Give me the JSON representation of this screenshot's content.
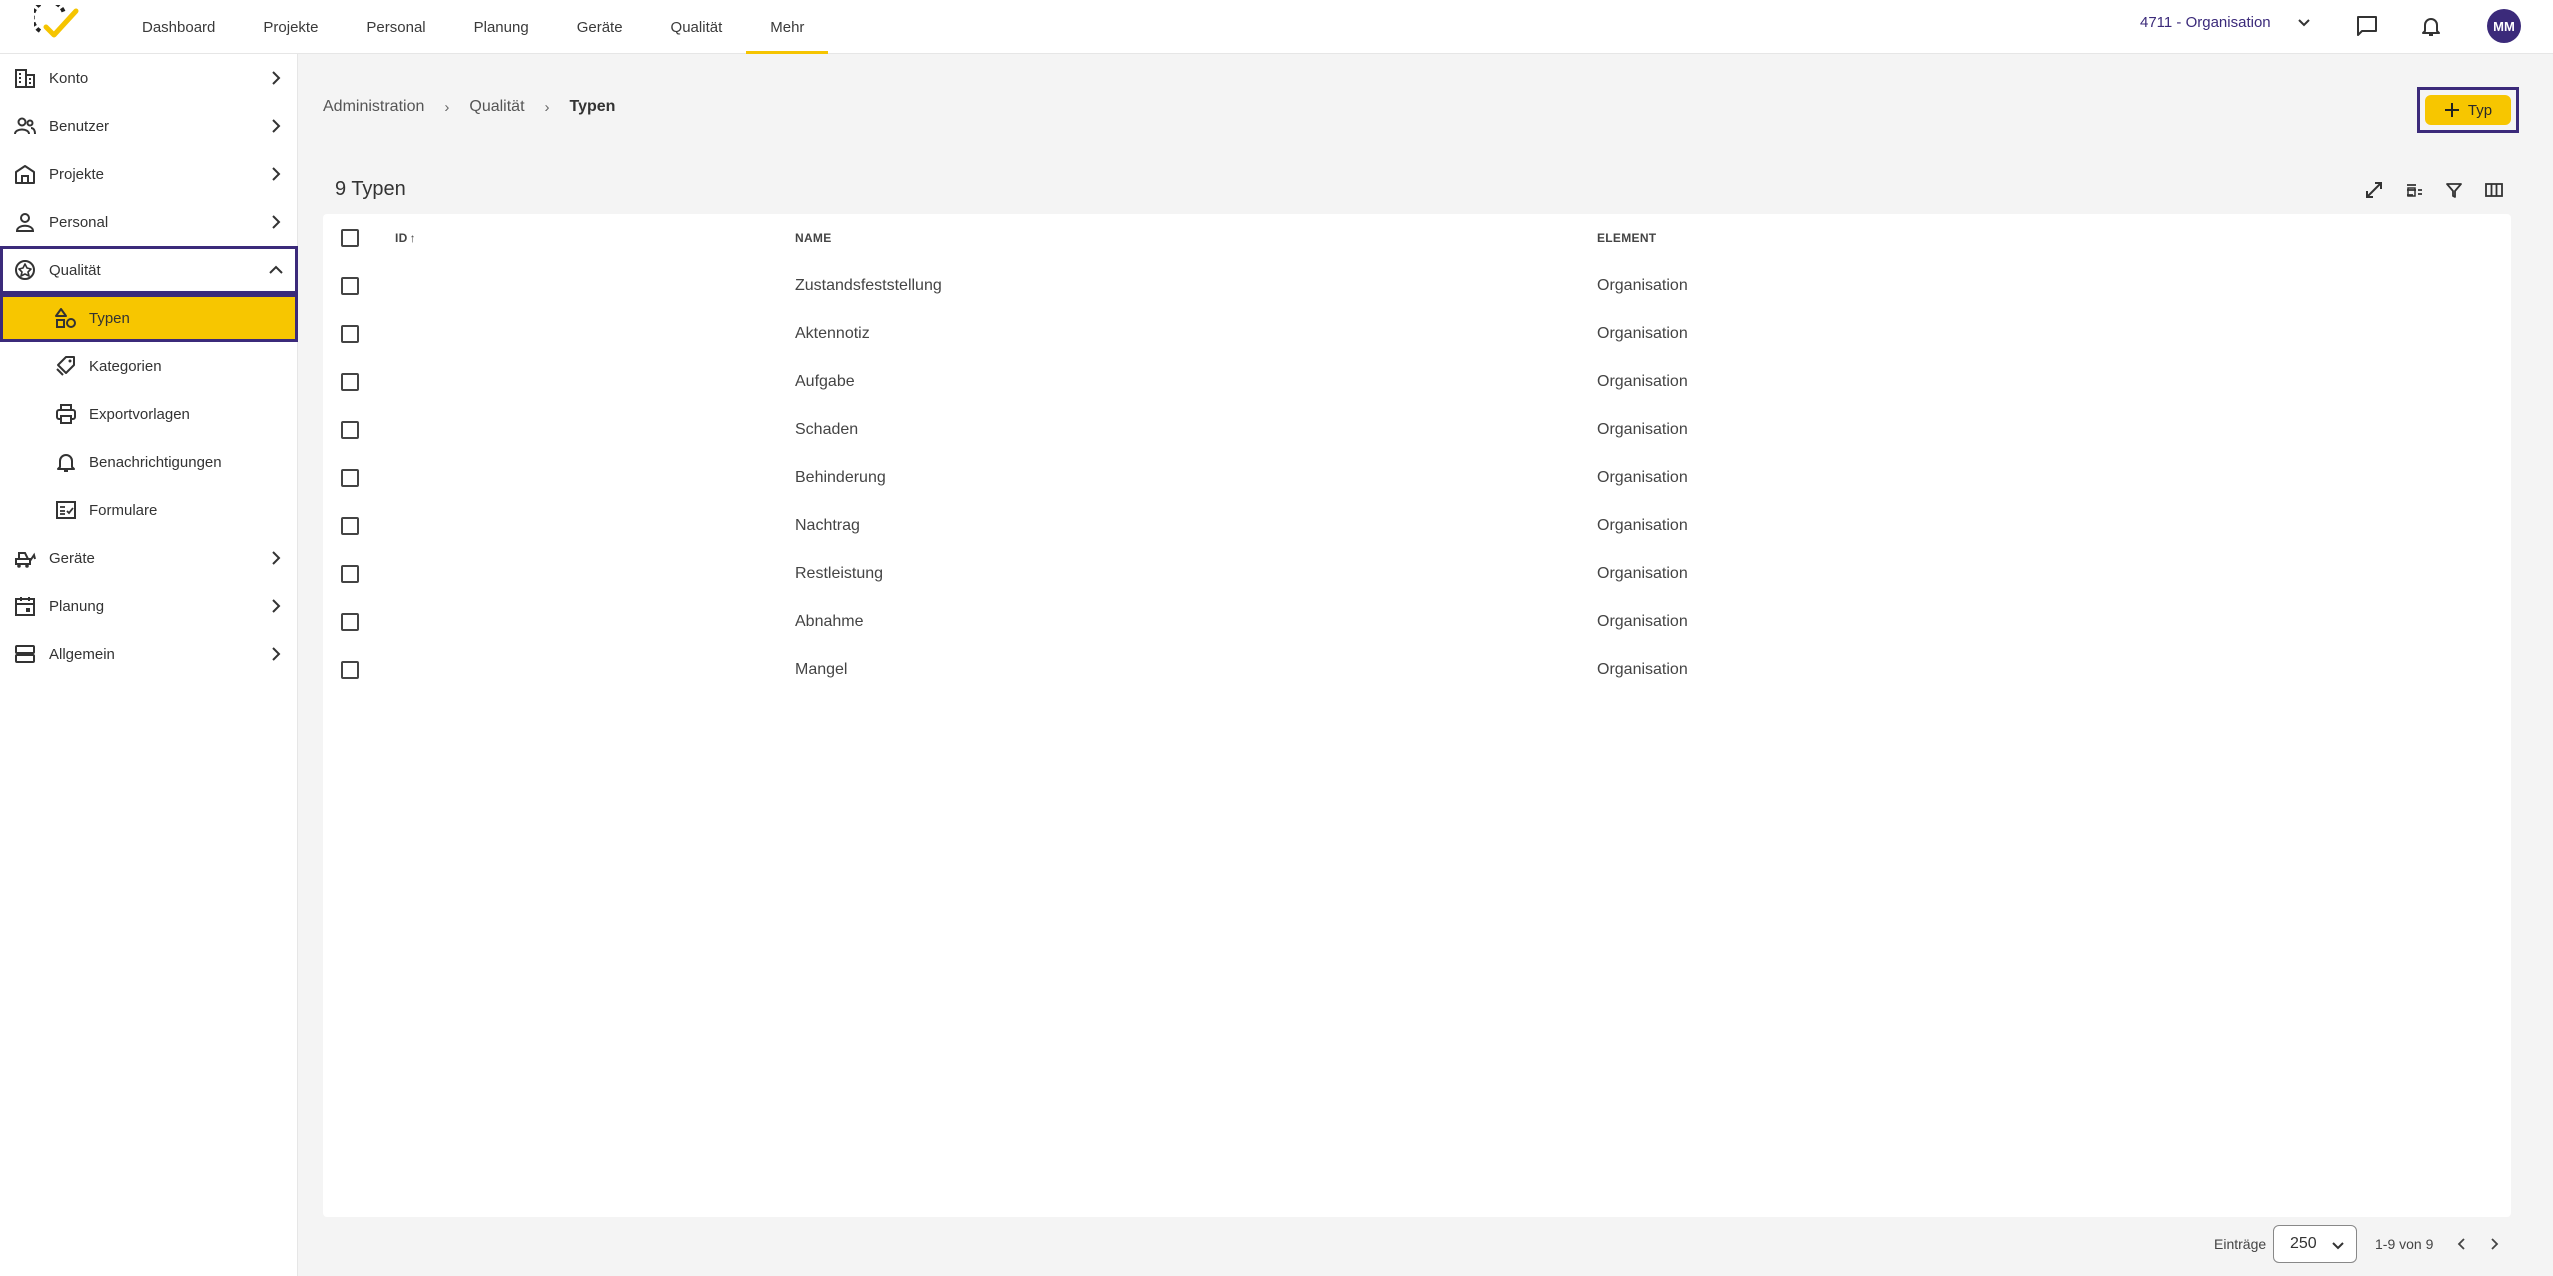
{
  "nav": {
    "items": [
      {
        "label": "Dashboard",
        "active": false
      },
      {
        "label": "Projekte",
        "active": false
      },
      {
        "label": "Personal",
        "active": false
      },
      {
        "label": "Planung",
        "active": false
      },
      {
        "label": "Geräte",
        "active": false
      },
      {
        "label": "Qualität",
        "active": false
      },
      {
        "label": "Mehr",
        "active": true
      }
    ],
    "org_label": "4711 - Organisation",
    "avatar_initials": "MM"
  },
  "sidebar": {
    "items": [
      {
        "label": "Konto",
        "icon": "building-icon"
      },
      {
        "label": "Benutzer",
        "icon": "users-icon"
      },
      {
        "label": "Projekte",
        "icon": "house-icon"
      },
      {
        "label": "Personal",
        "icon": "person-icon"
      },
      {
        "label": "Qualität",
        "icon": "badge-icon",
        "expanded": true
      },
      {
        "label": "Geräte",
        "icon": "machine-icon"
      },
      {
        "label": "Planung",
        "icon": "calendar-icon"
      },
      {
        "label": "Allgemein",
        "icon": "server-icon"
      }
    ],
    "sub_items": [
      {
        "label": "Typen",
        "icon": "shapes-icon",
        "selected": true
      },
      {
        "label": "Kategorien",
        "icon": "tags-icon"
      },
      {
        "label": "Exportvorlagen",
        "icon": "printer-icon"
      },
      {
        "label": "Benachrichtigungen",
        "icon": "bell-icon"
      },
      {
        "label": "Formulare",
        "icon": "form-icon"
      }
    ]
  },
  "breadcrumb": {
    "items": [
      "Administration",
      "Qualität",
      "Typen"
    ]
  },
  "add_button": {
    "label": "Typ"
  },
  "table": {
    "count_label": "9 Typen",
    "columns": [
      "ID",
      "NAME",
      "ELEMENT"
    ],
    "sort": {
      "column": "ID",
      "direction": "asc"
    },
    "rows": [
      {
        "id": "",
        "name": "Zustandsfeststellung",
        "element": "Organisation"
      },
      {
        "id": "",
        "name": "Aktennotiz",
        "element": "Organisation"
      },
      {
        "id": "",
        "name": "Aufgabe",
        "element": "Organisation"
      },
      {
        "id": "",
        "name": "Schaden",
        "element": "Organisation"
      },
      {
        "id": "",
        "name": "Behinderung",
        "element": "Organisation"
      },
      {
        "id": "",
        "name": "Nachtrag",
        "element": "Organisation"
      },
      {
        "id": "",
        "name": "Restleistung",
        "element": "Organisation"
      },
      {
        "id": "",
        "name": "Abnahme",
        "element": "Organisation"
      },
      {
        "id": "",
        "name": "Mangel",
        "element": "Organisation"
      }
    ]
  },
  "pagination": {
    "entries_label": "Einträge",
    "page_size": "250",
    "range_label": "1-9 von 9"
  },
  "colors": {
    "accent": "#f7c600",
    "brand": "#3b2a7a"
  }
}
